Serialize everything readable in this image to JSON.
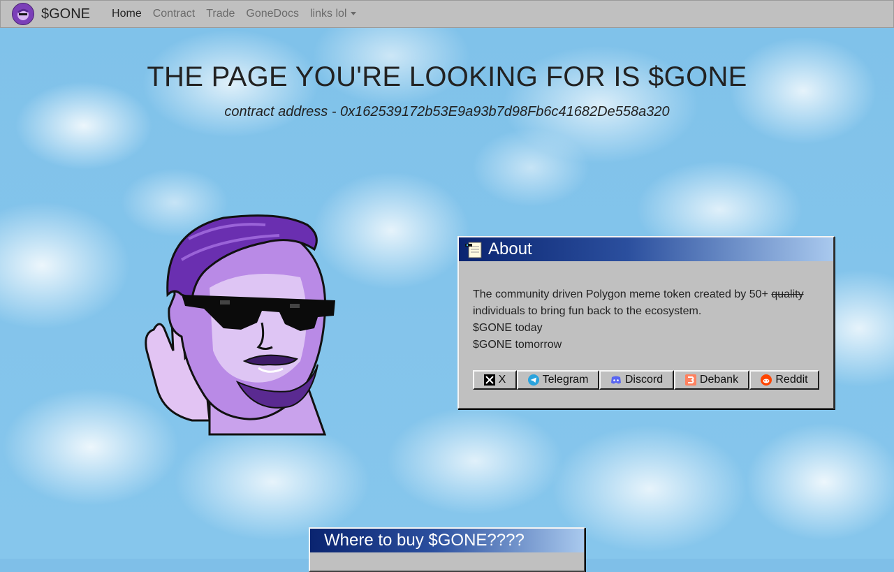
{
  "navbar": {
    "brand": "$GONE",
    "links": [
      "Home",
      "Contract",
      "Trade",
      "GoneDocs",
      "links lol"
    ]
  },
  "hero": {
    "title": "THE PAGE YOU'RE LOOKING FOR IS $GONE",
    "subtitle": "contract address - 0x162539172b53E9a93b7d98Fb6c41682De558a320"
  },
  "about": {
    "title": "About",
    "line1_pre": "The community driven Polygon meme token created by 50+ ",
    "line1_strike": "quality",
    "line2": "individuals to bring fun back to the ecosystem.",
    "line3": "$GONE today",
    "line4": "$GONE tomorrow",
    "buttons": [
      "X",
      "Telegram",
      "Discord",
      "Debank",
      "Reddit"
    ]
  },
  "buy": {
    "title": "Where to buy $GONE????"
  },
  "colors": {
    "navbar_bg": "#c0c0c0",
    "title_bar_start": "#0a2470",
    "title_bar_end": "#a9c9ee",
    "mascot_purple": "#8a4fd0"
  }
}
